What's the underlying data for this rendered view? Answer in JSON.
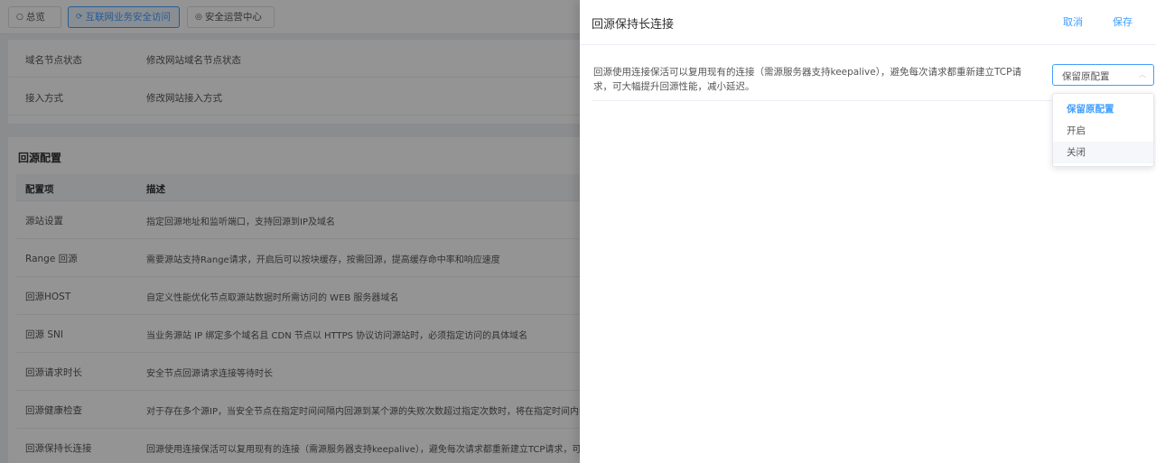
{
  "top_tabs": [
    {
      "icon": "○",
      "label": "总览"
    },
    {
      "icon": "⟳",
      "label": "互联网业务安全访问"
    },
    {
      "icon": "◎",
      "label": "安全运营中心"
    }
  ],
  "card1": {
    "rows": [
      {
        "key": "域名节点状态",
        "value": "修改网站域名节点状态"
      },
      {
        "key": "接入方式",
        "value": "修改网站接入方式"
      }
    ]
  },
  "origin_config": {
    "title": "回源配置",
    "headers": [
      "配置项",
      "描述"
    ],
    "rows": [
      {
        "key": "源站设置",
        "value": "指定回源地址和监听端口，支持回源到IP及域名"
      },
      {
        "key": "Range 回源",
        "value": "需要源站支持Range请求，开启后可以按块缓存，按需回源，提高缓存命中率和响应速度"
      },
      {
        "key": "回源HOST",
        "value": "自定义性能优化节点取源站数据时所需访问的 WEB 服务器域名"
      },
      {
        "key": "回源 SNI",
        "value": "当业务源站 IP 绑定多个域名且 CDN 节点以 HTTPS 协议访问源站时，必须指定访问的具体域名"
      },
      {
        "key": "回源请求时长",
        "value": "安全节点回源请求连接等待时长"
      },
      {
        "key": "回源健康检查",
        "value": "对于存在多个源IP，当安全节点在指定时间间隔内回源到某个源的失败次数超过指定次数时，将在指定时间内禁用此源IP"
      },
      {
        "key": "回源保持长连接",
        "value": "回源使用连接保活可以复用现有的连接（需源服务器支持keepalive），避免每次请求都重新建立TCP请求，可大幅提升"
      }
    ]
  },
  "drawer": {
    "title": "回源保持长连接",
    "cancel_label": "取消",
    "save_label": "保存",
    "description": "回源使用连接保活可以复用现有的连接（需源服务器支持keepalive），避免每次请求都重新建立TCP请求，可大幅提升回源性能，减小延迟。",
    "select": {
      "value": "保留原配置",
      "options": [
        "保留原配置",
        "开启",
        "关闭"
      ]
    }
  },
  "colors": {
    "accent": "#409eff",
    "overlay": "rgba(0,0,0,0.42)"
  }
}
